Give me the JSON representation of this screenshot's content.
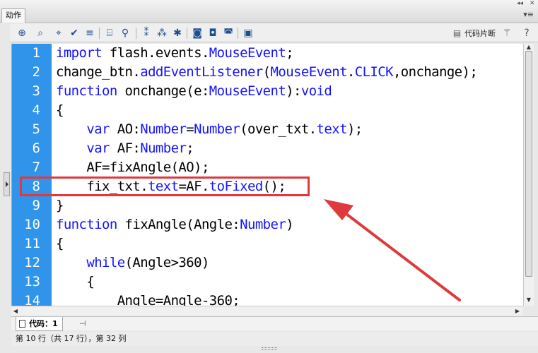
{
  "panel": {
    "title": "动作",
    "win_buttons": "◂◂  ✕",
    "menu_icon": "▾≡"
  },
  "toolbar": {
    "icons": [
      "add-statement-icon",
      "find-icon",
      "target-icon",
      "check-syntax-icon",
      "auto-format-icon",
      "code-hint-icon",
      "debug-options-icon",
      "collapse-between-braces-icon",
      "collapse-selection-icon",
      "expand-all-icon",
      "apply-block-comment-icon",
      "apply-line-comment-icon",
      "remove-comment-icon",
      "show-hide-toolbox-icon"
    ],
    "snippets_label": "代码片断",
    "wand_icon": "magic-wand-icon",
    "help_icon": "help-icon"
  },
  "code": {
    "lines": [
      {
        "num": "1",
        "text": "import flash.events.MouseEvent;"
      },
      {
        "num": "2",
        "text": "change_btn.addEventListener(MouseEvent.CLICK,onchange);"
      },
      {
        "num": "3",
        "text": "function onchange(e:MouseEvent):void"
      },
      {
        "num": "4",
        "text": "{"
      },
      {
        "num": "5",
        "text": "    var AO:Number=Number(over_txt.text);"
      },
      {
        "num": "6",
        "text": "    var AF:Number;"
      },
      {
        "num": "7",
        "text": "    AF=fixAngle(AO);"
      },
      {
        "num": "8",
        "text": "    fix_txt.text=AF.toFixed();"
      },
      {
        "num": "9",
        "text": "}"
      },
      {
        "num": "10",
        "text": "function fixAngle(Angle:Number)"
      },
      {
        "num": "11",
        "text": "{"
      },
      {
        "num": "12",
        "text": "    while(Angle>360)"
      },
      {
        "num": "13",
        "text": "    {"
      },
      {
        "num": "14",
        "text": "        Angle=Angle-360;"
      }
    ],
    "highlighted_line": "8"
  },
  "tabs": {
    "code_tab_label": "代码：1"
  },
  "status": {
    "text": "第 10 行（共 17 行），第 32 列"
  },
  "colors": {
    "gutter": "#2f94ea",
    "keyword": "#1414ff",
    "annotation": "#e0393c"
  }
}
